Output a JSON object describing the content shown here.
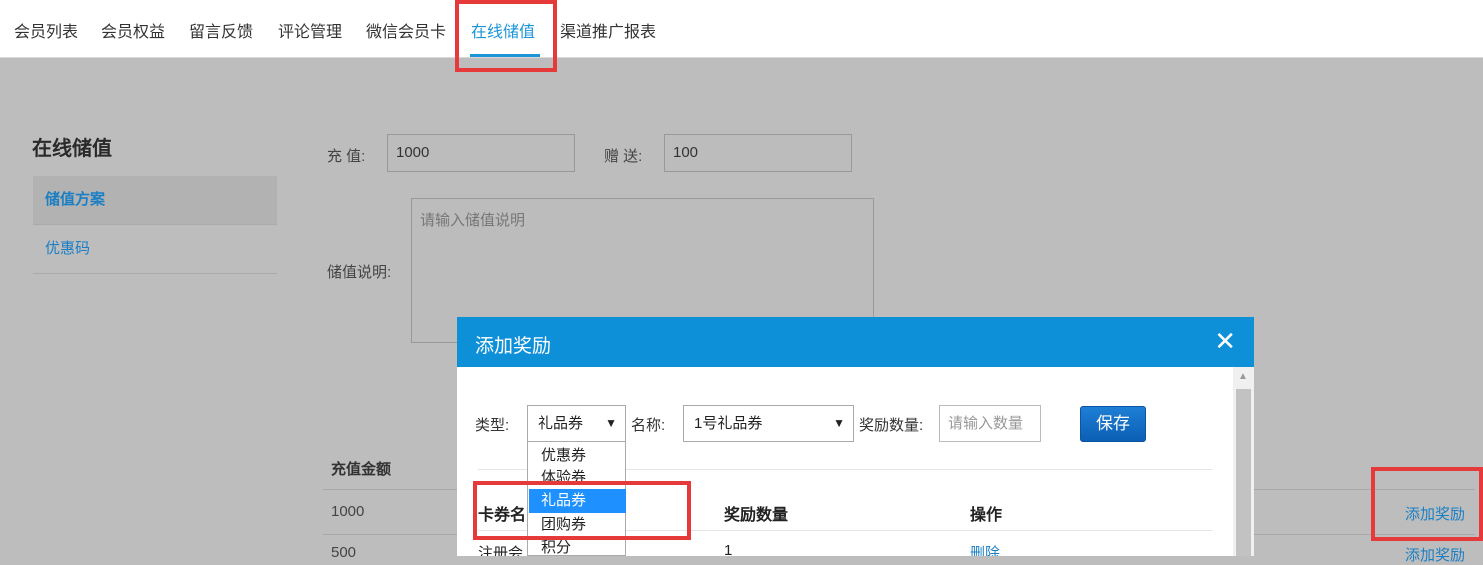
{
  "topnav": {
    "tabs": [
      {
        "label": "会员列表"
      },
      {
        "label": "会员权益"
      },
      {
        "label": "留言反馈"
      },
      {
        "label": "评论管理"
      },
      {
        "label": "微信会员卡"
      },
      {
        "label": "在线储值",
        "active": true
      },
      {
        "label": "渠道推广报表"
      }
    ]
  },
  "sidebar": {
    "title": "在线储值",
    "items": [
      {
        "label": "储值方案",
        "selected": true
      },
      {
        "label": "优惠码"
      }
    ]
  },
  "form": {
    "recharge_label": "充 值:",
    "recharge_value": "1000",
    "gift_label": "赠 送:",
    "gift_value": "100",
    "desc_label": "储值说明:",
    "desc_placeholder": "请输入储值说明"
  },
  "table": {
    "header_amount": "充值金额",
    "rows": [
      {
        "amount": "1000",
        "action": "添加奖励"
      },
      {
        "amount": "500",
        "action": "添加奖励"
      }
    ]
  },
  "dialog": {
    "title": "添加奖励",
    "close_icon": "close-icon",
    "type_label": "类型:",
    "type_value": "礼品券",
    "name_label": "名称:",
    "name_value": "1号礼品券",
    "qty_label": "奖励数量:",
    "qty_placeholder": "请输入数量",
    "save_label": "保存",
    "columns": [
      "卡券名",
      "奖励数量",
      "操作"
    ],
    "rows": [
      {
        "name": "注册会",
        "qty": "1",
        "action": "删除"
      }
    ],
    "type_options": [
      "优惠券",
      "体验券",
      "礼品券",
      "团购券",
      "积分"
    ],
    "highlighted_option": "礼品券"
  },
  "colors": {
    "accent": "#1b94d8",
    "dialog_header": "#0e90d9",
    "highlight_box": "#e63a3a"
  }
}
